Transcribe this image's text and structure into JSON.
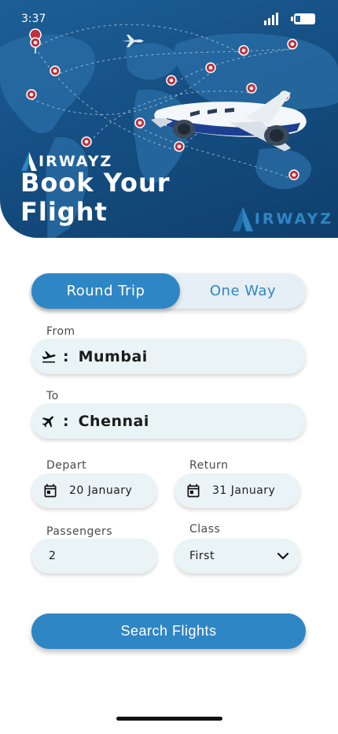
{
  "status_bar": {
    "time": "3:37"
  },
  "header": {
    "brand": "IRWAYZ",
    "title_line1": "Book Your",
    "title_line2": "Flight",
    "brand_large": "IRWAYZ"
  },
  "trip_toggle": {
    "round_trip": "Round Trip",
    "one_way": "One Way",
    "selected": "Round Trip"
  },
  "from": {
    "label": "From",
    "value": "Mumbai"
  },
  "to": {
    "label": "To",
    "value": "Chennai"
  },
  "depart": {
    "label": "Depart",
    "value": "20 January"
  },
  "return_date": {
    "label": "Return",
    "value": "31 January"
  },
  "passengers": {
    "label": "Passengers",
    "value": "2"
  },
  "travel_class": {
    "label": "Class",
    "value": "First"
  },
  "search_button": {
    "label": "Search Flights"
  },
  "colors": {
    "accent": "#2f86c5",
    "field_bg": "#eaf4f6",
    "hero_bg": "#154f83",
    "pin": "#c0313c"
  }
}
